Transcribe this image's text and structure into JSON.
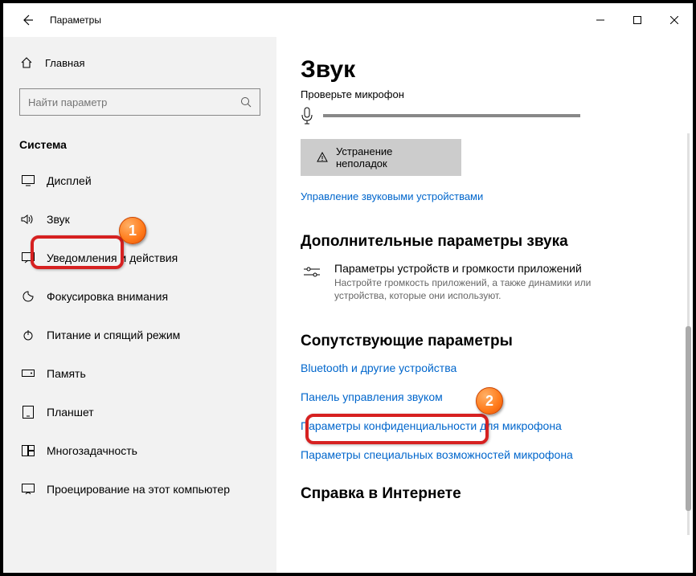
{
  "titlebar": {
    "title": "Параметры"
  },
  "sidebar": {
    "home": "Главная",
    "search_placeholder": "Найти параметр",
    "category": "Система",
    "items": [
      {
        "label": "Дисплей"
      },
      {
        "label": "Звук"
      },
      {
        "label": "Уведомления и действия"
      },
      {
        "label": "Фокусировка внимания"
      },
      {
        "label": "Питание и спящий режим"
      },
      {
        "label": "Память"
      },
      {
        "label": "Планшет"
      },
      {
        "label": "Многозадачность"
      },
      {
        "label": "Проецирование на этот компьютер"
      }
    ]
  },
  "content": {
    "title": "Звук",
    "test_mic": "Проверьте микрофон",
    "troubleshoot": "Устранение неполадок",
    "manage_devices": "Управление звуковыми устройствами",
    "advanced_h": "Дополнительные параметры звука",
    "app_vol_title": "Параметры устройств и громкости приложений",
    "app_vol_desc": "Настройте громкость приложений, а также динамики или устройства, которые они используют.",
    "related_h": "Сопутствующие параметры",
    "bt_link": "Bluetooth и другие устройства",
    "cp_link": "Панель управления звуком",
    "privacy_link": "Параметры конфиденциальности для микрофона",
    "ease_link": "Параметры специальных возможностей микрофона",
    "help_h": "Справка в Интернете"
  },
  "badges": {
    "b1": "1",
    "b2": "2"
  }
}
